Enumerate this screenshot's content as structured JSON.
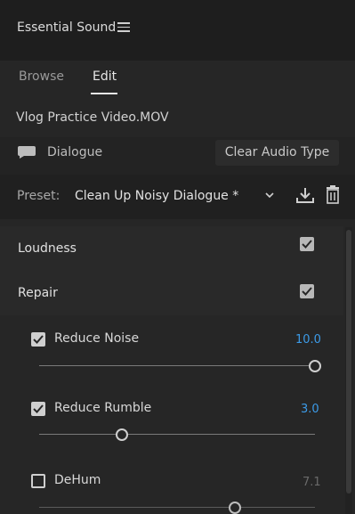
{
  "panel": {
    "title": "Essential Sound"
  },
  "tabs": [
    {
      "label": "Browse"
    },
    {
      "label": "Edit"
    }
  ],
  "clip": {
    "name": "Vlog Practice Video.MOV"
  },
  "audio_type": {
    "label": "Dialogue",
    "clear_button": "Clear Audio Type",
    "icon": "speech-bubble-icon"
  },
  "preset": {
    "label": "Preset:",
    "value": "Clean Up Noisy Dialogue *"
  },
  "sections": {
    "loudness": {
      "label": "Loudness",
      "checked": true
    },
    "repair": {
      "label": "Repair",
      "checked": true
    }
  },
  "effects": [
    {
      "label": "Reduce Noise",
      "checked": true,
      "value": "10.0",
      "level": 1.0
    },
    {
      "label": "Reduce Rumble",
      "checked": true,
      "value": "3.0",
      "level": 0.3
    },
    {
      "label": "DeHum",
      "checked": false,
      "value": "7.1",
      "level": 0.71
    }
  ],
  "colors": {
    "accent": "#3c9be8",
    "background": "#262626"
  }
}
